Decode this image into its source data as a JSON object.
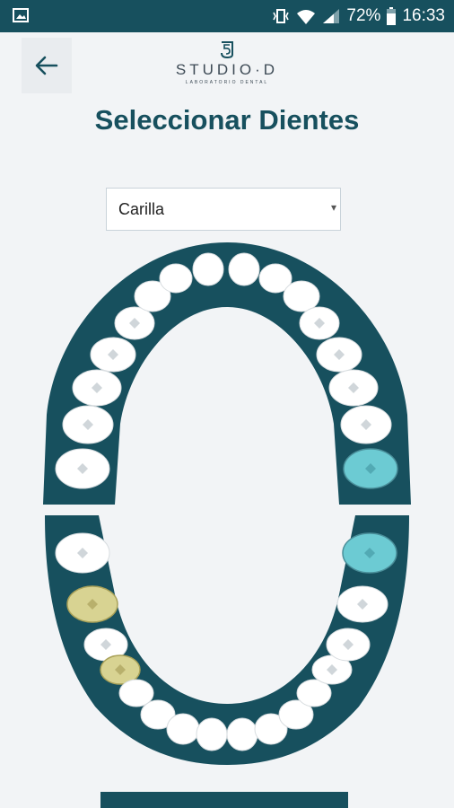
{
  "status_bar": {
    "battery": "72%",
    "time": "16:33"
  },
  "header": {
    "brand_name": "STUDIO·D",
    "brand_subtitle": "LABORATORIO DENTAL",
    "title": "Seleccionar Dientes"
  },
  "treatment_select": {
    "value": "Carilla"
  },
  "colors": {
    "primary": "#17505e",
    "background": "#f2f4f6",
    "tooth_default": "#ffffff",
    "tooth_selected_teal": "#6ccbd3",
    "tooth_selected_yellow": "#d8d392"
  },
  "upper_arch": {
    "teeth": [
      {
        "state": "default"
      },
      {
        "state": "default"
      },
      {
        "state": "default"
      },
      {
        "state": "default"
      },
      {
        "state": "default"
      },
      {
        "state": "default"
      },
      {
        "state": "default"
      },
      {
        "state": "default"
      },
      {
        "state": "default"
      },
      {
        "state": "default"
      },
      {
        "state": "default"
      },
      {
        "state": "default"
      },
      {
        "state": "default"
      },
      {
        "state": "default"
      },
      {
        "state": "default"
      },
      {
        "state": "teal"
      }
    ]
  },
  "lower_arch": {
    "teeth": [
      {
        "state": "default"
      },
      {
        "state": "yellow"
      },
      {
        "state": "default"
      },
      {
        "state": "yellow"
      },
      {
        "state": "default"
      },
      {
        "state": "default"
      },
      {
        "state": "default"
      },
      {
        "state": "default"
      },
      {
        "state": "default"
      },
      {
        "state": "default"
      },
      {
        "state": "default"
      },
      {
        "state": "default"
      },
      {
        "state": "default"
      },
      {
        "state": "default"
      },
      {
        "state": "default"
      },
      {
        "state": "teal"
      }
    ]
  }
}
